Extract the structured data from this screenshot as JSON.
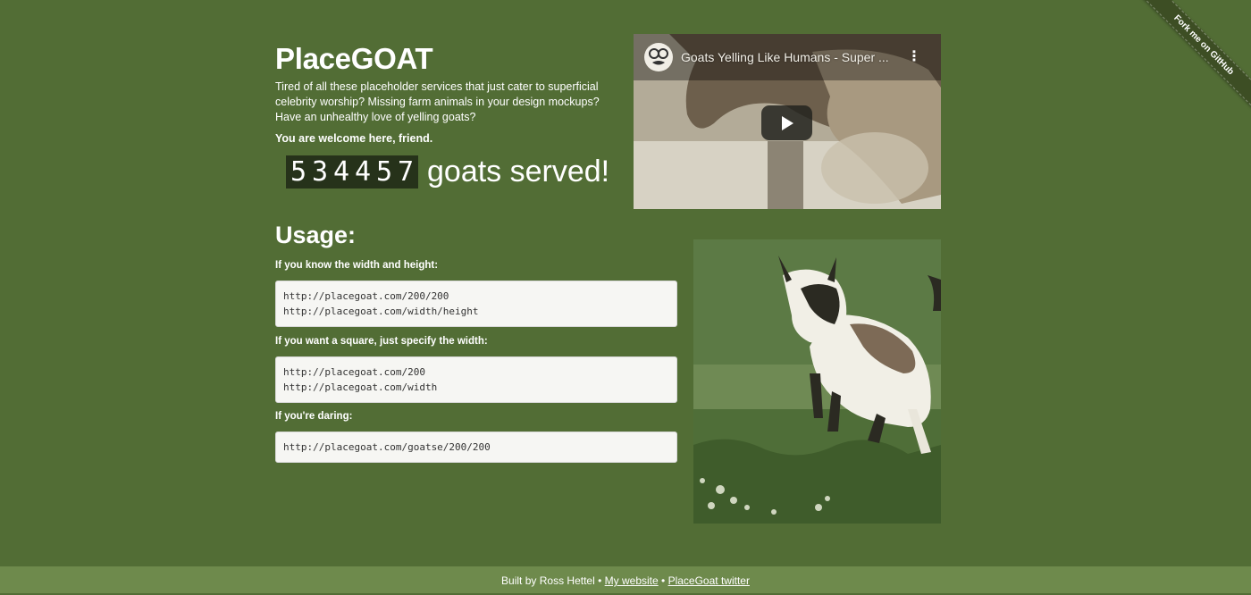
{
  "header": {
    "title": "PlaceGOAT",
    "intro": "Tired of all these placeholder services that just cater to superficial celebrity worship? Missing farm animals in your design mockups? Have an unhealthy love of yelling goats?",
    "welcome": "You are welcome here, friend."
  },
  "counter": {
    "digits": [
      "5",
      "3",
      "4",
      "4",
      "5",
      "7"
    ],
    "suffix": "goats served!"
  },
  "video": {
    "title": "Goats Yelling Like Humans - Super ...",
    "menu_icon": "more-vertical-icon",
    "play_icon": "play-icon"
  },
  "usage": {
    "heading": "Usage:",
    "sections": [
      {
        "label": "If you know the width and height:",
        "lines": [
          "http://placegoat.com/200/200",
          "http://placegoat.com/width/height"
        ]
      },
      {
        "label": "If you want a square, just specify the width:",
        "lines": [
          "http://placegoat.com/200",
          "http://placegoat.com/width"
        ]
      },
      {
        "label": "If you're daring:",
        "lines": [
          "http://placegoat.com/goatse/200/200"
        ]
      }
    ]
  },
  "ribbon": {
    "label": "Fork me on GitHub"
  },
  "footer": {
    "built_by": "Built by Ross Hettel",
    "separator": "•",
    "link_website": "My website",
    "link_twitter": "PlaceGoat twitter"
  },
  "colors": {
    "background": "#526d35",
    "footer": "#6e8a4c",
    "counter_bg": "#26321a",
    "ribbon": "#3d4e24"
  }
}
